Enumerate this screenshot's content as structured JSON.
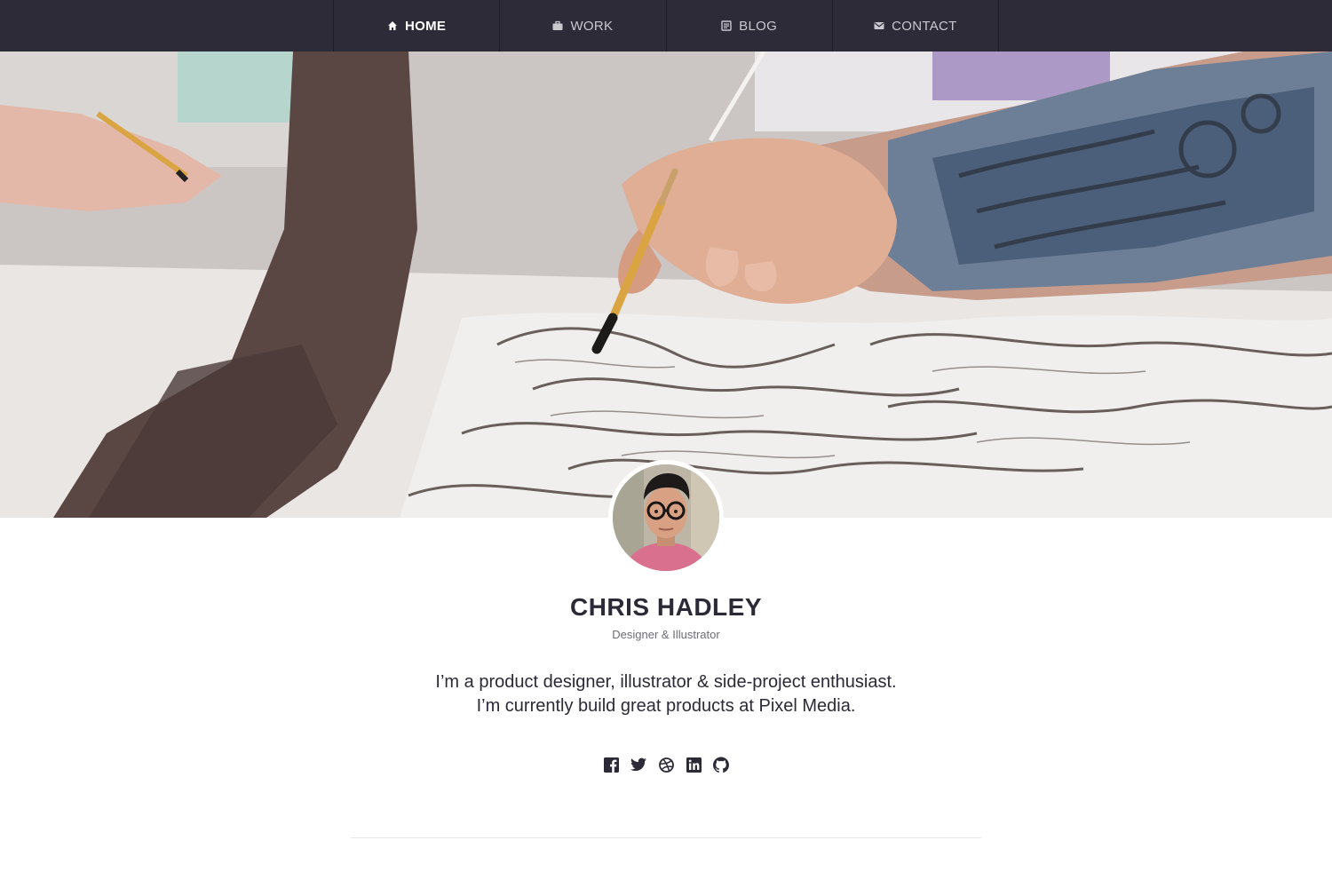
{
  "nav": {
    "items": [
      {
        "label": "HOME",
        "icon": "home-icon",
        "active": true
      },
      {
        "label": "WORK",
        "icon": "briefcase-icon",
        "active": false
      },
      {
        "label": "BLOG",
        "icon": "blog-icon",
        "active": false
      },
      {
        "label": "CONTACT",
        "icon": "mail-icon",
        "active": false
      }
    ]
  },
  "profile": {
    "name": "CHRIS HADLEY",
    "role": "Designer & Illustrator",
    "bio_line1": "I’m a product designer, illustrator & side-project enthusiast.",
    "bio_line2": "I’m currently build great products at Pixel Media."
  },
  "social": [
    {
      "icon": "facebook-icon"
    },
    {
      "icon": "twitter-icon"
    },
    {
      "icon": "dribbble-icon"
    },
    {
      "icon": "linkedin-icon"
    },
    {
      "icon": "github-icon"
    }
  ],
  "colors": {
    "nav_bg": "#2e2b38",
    "text_dark": "#2c2a37",
    "text_muted": "#6e6c76"
  }
}
